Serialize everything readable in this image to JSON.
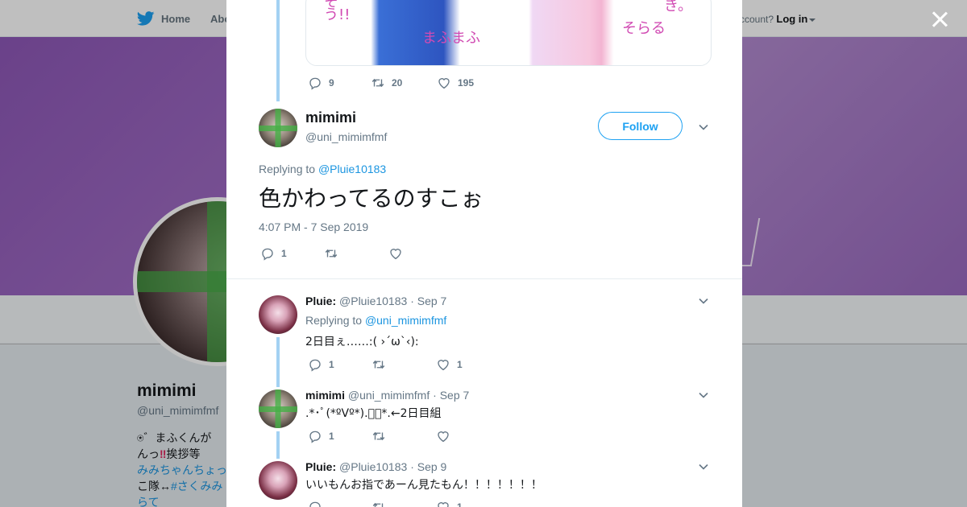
{
  "topnav": {
    "home_label": "Home",
    "about_label": "Abo",
    "account_prompt": "ccount?",
    "login_label": "Log in"
  },
  "profile": {
    "name": "mimimi",
    "handle": "@uni_mimimfmf",
    "bio_line1": "⍟゛まふくんが",
    "bio_line2_a": "んっ",
    "bio_line2_mark": "‼",
    "bio_line2_b": "挨拶等",
    "bio_line3": "みみちゃんちょっ",
    "bio_line4_a": "こ隊↔",
    "bio_line4_link": "#さくみみ",
    "bio_line5": "らて"
  },
  "prev_tweet": {
    "media_scribbles": [
      "そう!!",
      "まふまふ",
      "そらる",
      "き。"
    ],
    "replies": "9",
    "retweets": "20",
    "likes": "195"
  },
  "main_tweet": {
    "name": "mimimi",
    "handle": "@uni_mimimfmf",
    "follow_label": "Follow",
    "replying_prefix": "Replying to",
    "replying_to": "@Pluie10183",
    "text": "色かわってるのすこぉ",
    "timestamp": "4:07 PM - 7 Sep 2019",
    "replies": "1",
    "retweets": "",
    "likes": ""
  },
  "replies": [
    {
      "name": "Pluie:",
      "handle": "@Pluie10183",
      "date": "· Sep 7",
      "replying_prefix": "Replying to",
      "replying_to": "@uni_mimimfmf",
      "text": "2日目ぇ……:( ›´ω`‹):",
      "replies": "1",
      "retweets": "",
      "likes": "1"
    },
    {
      "name": "mimimi",
      "handle": "@uni_mimimfmf",
      "date": "· Sep 7",
      "text": ".*･ﾟ(*ºVº*).ﾟ･*.←2日目組",
      "replies": "1",
      "retweets": "",
      "likes": ""
    },
    {
      "name": "Pluie:",
      "handle": "@Pluie10183",
      "date": "· Sep 9",
      "text": "いいもんお指であーん見たもん！！！！！！！",
      "replies": "",
      "retweets": "",
      "likes": "1"
    }
  ],
  "colors": {
    "accent": "#1da1f2",
    "link": "#1b95e0",
    "muted": "#657786",
    "thread_line": "#a3d1f3",
    "banner": "#9a6abf"
  }
}
